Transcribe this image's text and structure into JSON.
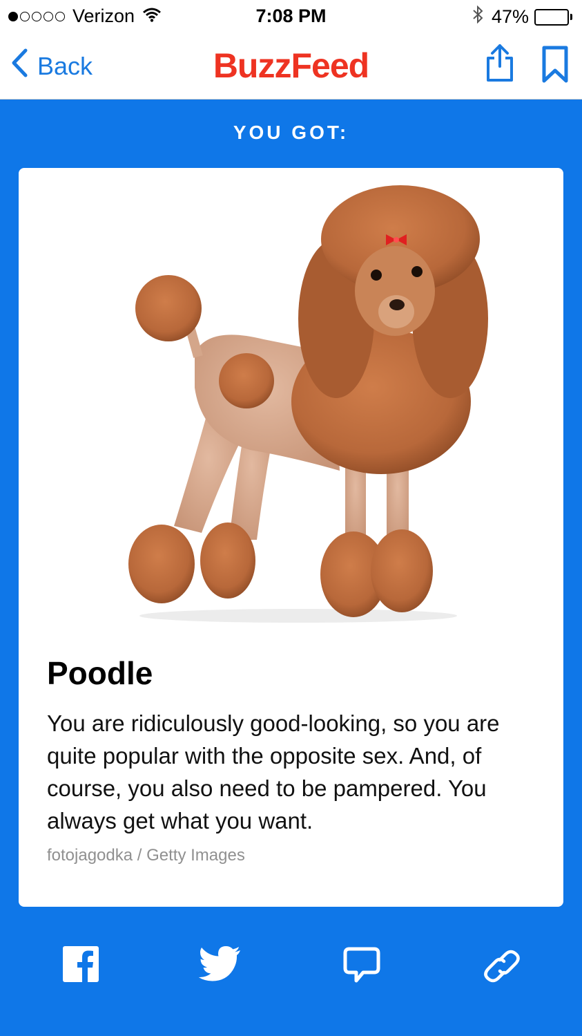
{
  "status_bar": {
    "carrier": "Verizon",
    "time": "7:08 PM",
    "battery_percent": "47%",
    "battery_level": 0.47
  },
  "nav": {
    "back_label": "Back",
    "logo_text": "BuzzFeed",
    "share_icon": "share-icon",
    "bookmark_icon": "bookmark-icon"
  },
  "result": {
    "heading": "YOU GOT:",
    "title": "Poodle",
    "description": "You are ridiculously good-looking, so you are quite popular with the opposite sex. And, of course, you also need to be pampered. You always get what you want.",
    "credit": "fotojagodka / Getty Images"
  },
  "share_buttons": [
    "facebook-icon",
    "twitter-icon",
    "comment-icon",
    "link-icon"
  ],
  "colors": {
    "accent_blue": "#0f77e8",
    "link_blue": "#1a7ae0",
    "brand_red": "#ee3322",
    "poodle_fur": "#b8683a"
  }
}
